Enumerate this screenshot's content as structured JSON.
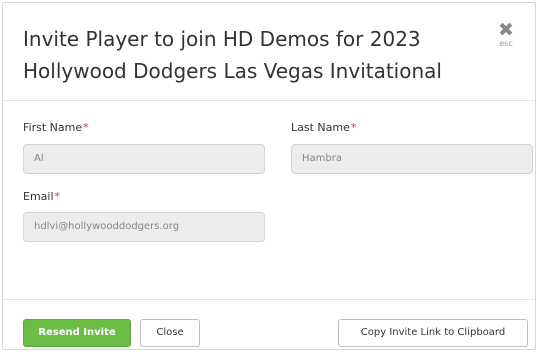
{
  "modal": {
    "title": "Invite Player to join HD Demos for 2023 Hollywood Dodgers Las Vegas Invitational",
    "close_symbol": "✖",
    "close_hint": "esc"
  },
  "form": {
    "first_name": {
      "label": "First Name",
      "required_mark": "*",
      "value": "Al"
    },
    "last_name": {
      "label": "Last Name",
      "required_mark": "*",
      "value": "Hambra"
    },
    "email": {
      "label": "Email",
      "required_mark": "*",
      "value": "hdlvi@hollywooddodgers.org"
    }
  },
  "footer": {
    "resend_label": "Resend Invite",
    "close_label": "Close",
    "copy_link_label": "Copy Invite Link to Clipboard"
  },
  "colors": {
    "primary_button": "#6cbd45",
    "required_asterisk": "#d9333f"
  },
  "icons": {
    "close": "close-icon"
  }
}
